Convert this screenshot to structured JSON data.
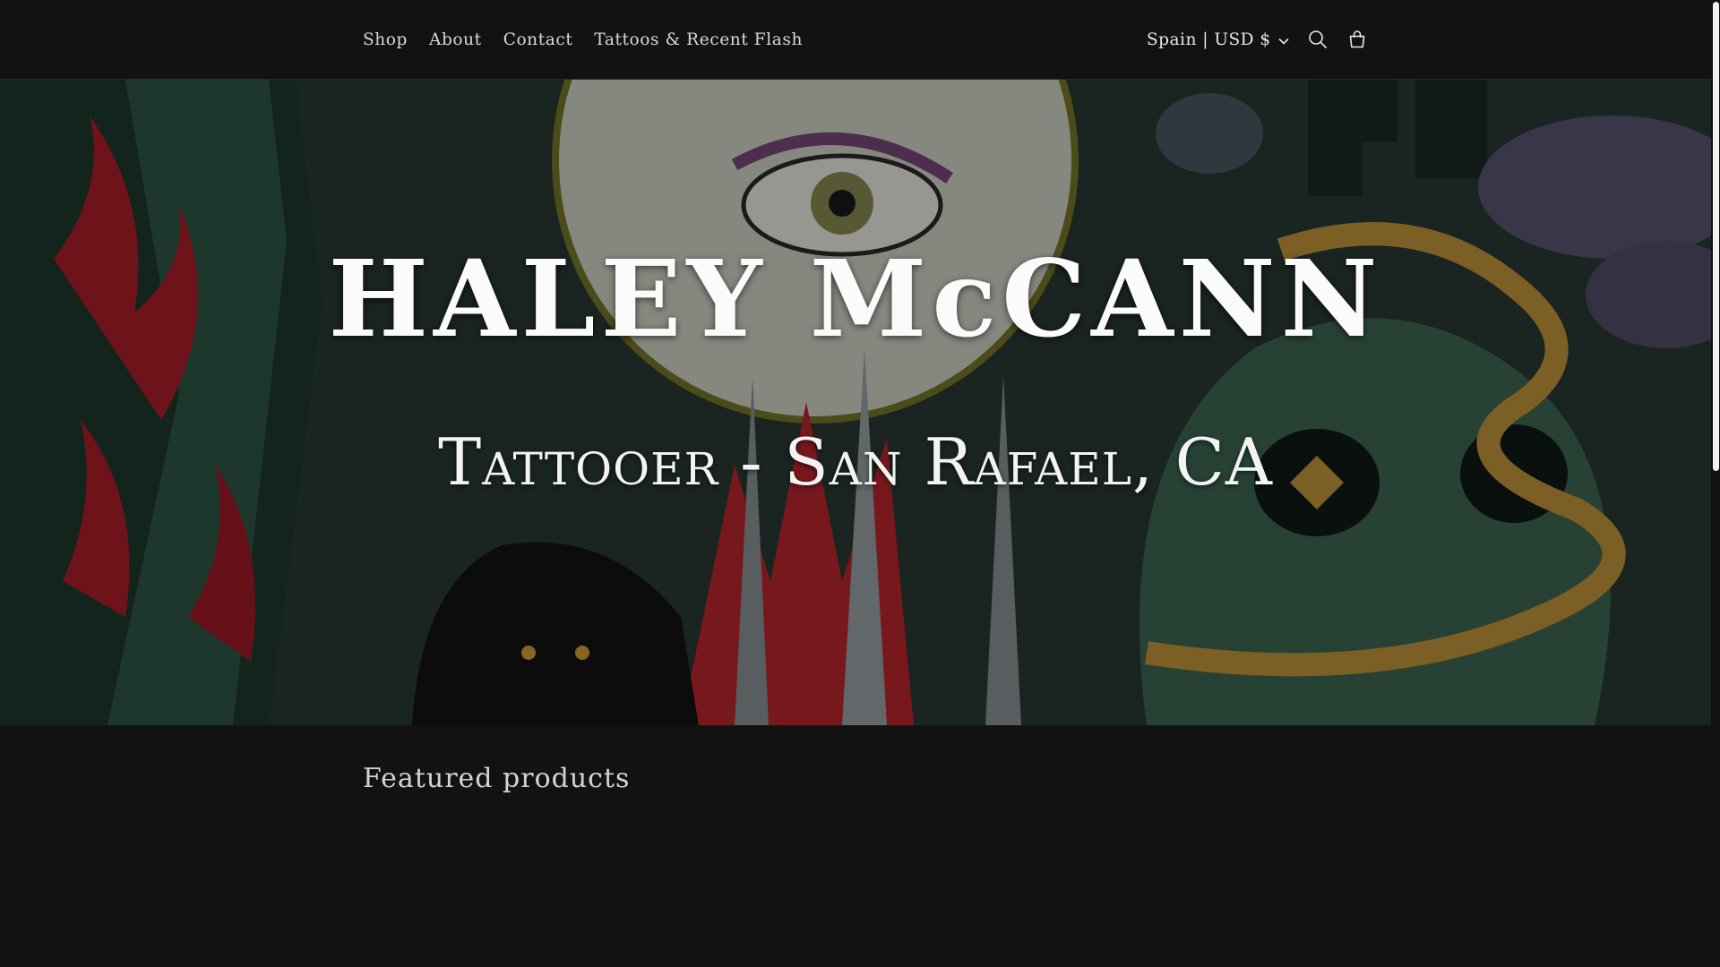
{
  "nav": {
    "items": [
      {
        "label": "Shop"
      },
      {
        "label": "About"
      },
      {
        "label": "Contact"
      },
      {
        "label": "Tattoos & Recent Flash"
      }
    ]
  },
  "localization": {
    "label": "Spain | USD $"
  },
  "icons": {
    "chevron": "chevron-down-icon",
    "search": "search-icon",
    "cart": "cart-icon"
  },
  "hero": {
    "title": "HALEY McCANN",
    "subtitle": "Tattooer - San Rafael, CA"
  },
  "featured": {
    "heading": "Featured products"
  },
  "colors": {
    "background": "#121212",
    "text": "#d9d9d9",
    "hero_red": "#b3202b",
    "hero_green": "#2f5a4a",
    "hero_gold": "#c99a3a"
  }
}
